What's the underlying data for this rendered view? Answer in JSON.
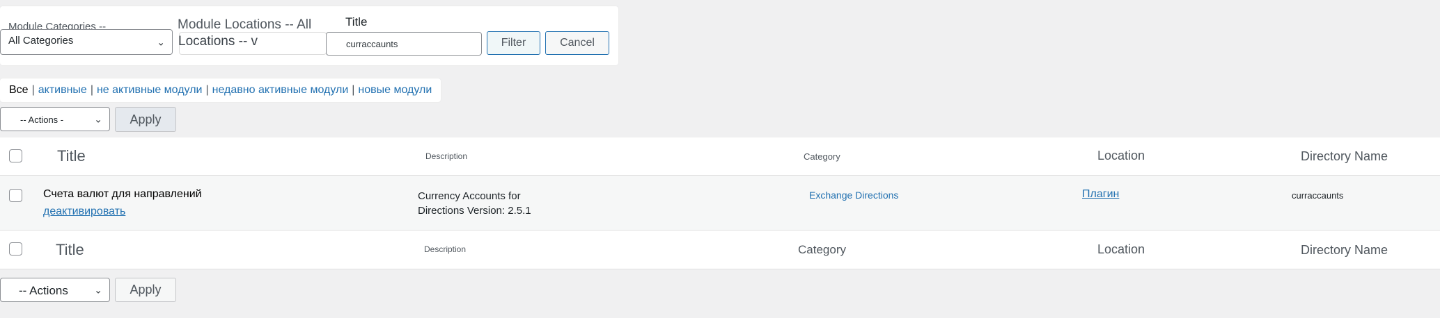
{
  "filters": {
    "categories_label": "Module Categories --",
    "categories_value": "All Categories",
    "locations_label": "Module Locations -- All",
    "locations_value": "Locations -- v",
    "title_label": "Title",
    "title_value": "curraccaunts",
    "filter_button": "Filter",
    "cancel_button": "Cancel"
  },
  "views": [
    {
      "label": "Все",
      "current": true
    },
    {
      "label": "активные"
    },
    {
      "label": "не активные модули"
    },
    {
      "label": "недавно активные модули"
    },
    {
      "label": "новые модули"
    }
  ],
  "separator": "|",
  "bulk_top": {
    "actions": "-- Actions -",
    "apply": "Apply"
  },
  "bulk_bottom": {
    "actions": "-- Actions",
    "apply": "Apply"
  },
  "table": {
    "header": {
      "title": "Title",
      "description": "Description",
      "category": "Category",
      "location": "Location",
      "directory": "Directory Name"
    },
    "rows": [
      {
        "title": "Счета валют для направлений",
        "action": "деактивировать",
        "description_line1": "Currency Accounts for",
        "description_line2": "Directions Version: 2.5.1",
        "category": "Exchange Directions",
        "location": "Плагин",
        "directory": "curraccaunts"
      }
    ]
  }
}
